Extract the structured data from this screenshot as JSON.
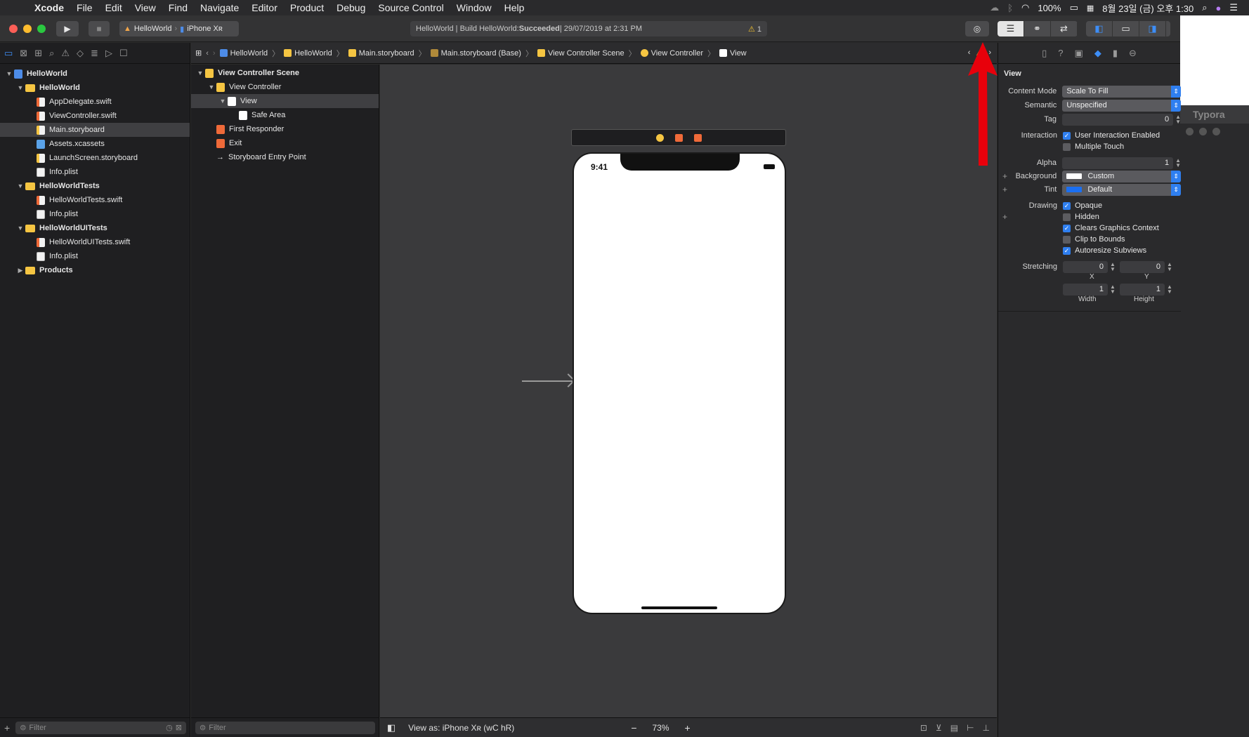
{
  "menubar": {
    "app": "Xcode",
    "menus": [
      "File",
      "Edit",
      "View",
      "Find",
      "Navigate",
      "Editor",
      "Product",
      "Debug",
      "Source Control",
      "Window",
      "Help"
    ],
    "battery": "100%",
    "datetime": "8월 23일 (금) 오후 1:30"
  },
  "toolbar": {
    "scheme_project": "HelloWorld",
    "scheme_device": "iPhone Xʀ",
    "activity_text": "HelloWorld | Build HelloWorld: ",
    "activity_status": "Succeeded",
    "activity_time": " | 29/07/2019 at 2:31 PM",
    "warning_count": "1"
  },
  "navigator": {
    "items": [
      {
        "label": "HelloWorld",
        "level": 0,
        "type": "proj",
        "disclosure": "▼",
        "group": true
      },
      {
        "label": "HelloWorld",
        "level": 1,
        "type": "folder",
        "disclosure": "▼",
        "group": true
      },
      {
        "label": "AppDelegate.swift",
        "level": 2,
        "type": "swift",
        "disclosure": ""
      },
      {
        "label": "ViewController.swift",
        "level": 2,
        "type": "swift",
        "disclosure": ""
      },
      {
        "label": "Main.storyboard",
        "level": 2,
        "type": "storyboard",
        "disclosure": "",
        "selected": true
      },
      {
        "label": "Assets.xcassets",
        "level": 2,
        "type": "assets",
        "disclosure": ""
      },
      {
        "label": "LaunchScreen.storyboard",
        "level": 2,
        "type": "storyboard",
        "disclosure": ""
      },
      {
        "label": "Info.plist",
        "level": 2,
        "type": "doc",
        "disclosure": ""
      },
      {
        "label": "HelloWorldTests",
        "level": 1,
        "type": "folder",
        "disclosure": "▼",
        "group": true
      },
      {
        "label": "HelloWorldTests.swift",
        "level": 2,
        "type": "swift",
        "disclosure": ""
      },
      {
        "label": "Info.plist",
        "level": 2,
        "type": "doc",
        "disclosure": ""
      },
      {
        "label": "HelloWorldUITests",
        "level": 1,
        "type": "folder",
        "disclosure": "▼",
        "group": true
      },
      {
        "label": "HelloWorldUITests.swift",
        "level": 2,
        "type": "swift",
        "disclosure": ""
      },
      {
        "label": "Info.plist",
        "level": 2,
        "type": "doc",
        "disclosure": ""
      },
      {
        "label": "Products",
        "level": 1,
        "type": "folder",
        "disclosure": "▶",
        "group": true
      }
    ],
    "filter_placeholder": "Filter"
  },
  "jumpbar": {
    "crumbs": [
      "HelloWorld",
      "HelloWorld",
      "Main.storyboard",
      "Main.storyboard (Base)",
      "View Controller Scene",
      "View Controller",
      "View"
    ]
  },
  "outline": {
    "items": [
      {
        "label": "View Controller Scene",
        "level": 0,
        "disclosure": "▼",
        "bold": true,
        "icon": "#f5c542"
      },
      {
        "label": "View Controller",
        "level": 1,
        "disclosure": "▼",
        "icon": "#f5c542"
      },
      {
        "label": "View",
        "level": 2,
        "disclosure": "▼",
        "icon": "#ffffff",
        "selected": true
      },
      {
        "label": "Safe Area",
        "level": 3,
        "disclosure": "",
        "icon": "#ffffff"
      },
      {
        "label": "First Responder",
        "level": 1,
        "disclosure": "",
        "icon": "#ef6a39"
      },
      {
        "label": "Exit",
        "level": 1,
        "disclosure": "",
        "icon": "#ef6a39"
      },
      {
        "label": "Storyboard Entry Point",
        "level": 1,
        "disclosure": "",
        "icon": "arrow"
      }
    ],
    "filter_placeholder": "Filter"
  },
  "canvas": {
    "phone_time": "9:41",
    "view_as": "View as: iPhone Xʀ (wC hR)",
    "zoom": "73%"
  },
  "inspector": {
    "title": "View",
    "content_mode_label": "Content Mode",
    "content_mode": "Scale To Fill",
    "semantic_label": "Semantic",
    "semantic": "Unspecified",
    "tag_label": "Tag",
    "tag": "0",
    "interaction_label": "Interaction",
    "user_interaction": "User Interaction Enabled",
    "multiple_touch": "Multiple Touch",
    "alpha_label": "Alpha",
    "alpha": "1",
    "background_label": "Background",
    "background": "Custom",
    "tint_label": "Tint",
    "tint": "Default",
    "drawing_label": "Drawing",
    "opaque": "Opaque",
    "hidden": "Hidden",
    "clears_graphics": "Clears Graphics Context",
    "clip_to_bounds": "Clip to Bounds",
    "autoresize": "Autoresize Subviews",
    "stretching_label": "Stretching",
    "stretch_x": "0",
    "stretch_y": "0",
    "stretch_w": "1",
    "stretch_h": "1",
    "x_label": "X",
    "y_label": "Y",
    "width_label": "Width",
    "height_label": "Height"
  },
  "background_window": {
    "title": "Typora"
  },
  "colors": {
    "accent": "#2f7ff0",
    "annotation": "#e8000b"
  }
}
